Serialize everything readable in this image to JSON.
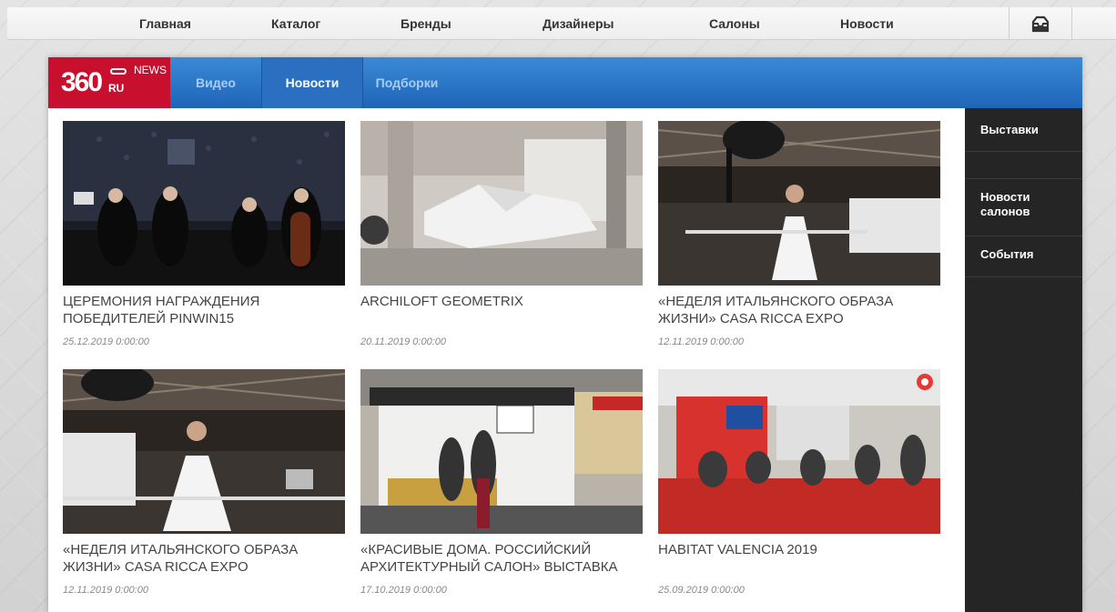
{
  "topnav": {
    "items": [
      "Главная",
      "Каталог",
      "Бренды",
      "Дизайнеры",
      "Салоны",
      "Новости"
    ]
  },
  "logo": {
    "main": "360",
    "badge": "NEWS",
    "ru": "RU"
  },
  "tabs": [
    "Видео",
    "Новости",
    "Подборки"
  ],
  "articles": [
    {
      "title": "Церемония награждения победителей PINWIN15",
      "date": "25.12.2019 0:00:00"
    },
    {
      "title": "ARCHILOFT GEOMETRIX",
      "date": "20.11.2019 0:00:00"
    },
    {
      "title": "«Неделя итальянского образа жизни» CASA RICCA EXPO",
      "date": "12.11.2019 0:00:00"
    },
    {
      "title": "«Неделя итальянского образа жизни» CASA RICCA EXPO",
      "date": "12.11.2019 0:00:00"
    },
    {
      "title": "«Красивые дома. Российский архитектурный салон» выставка",
      "date": "17.10.2019 0:00:00"
    },
    {
      "title": "HABITAT VALENCIA 2019",
      "date": "25.09.2019 0:00:00"
    }
  ],
  "sidebar": {
    "items": [
      "Выставки",
      "Новости салонов",
      "События"
    ]
  },
  "icons": {
    "cart": "cart-icon"
  },
  "colors": {
    "header_blue": "#2a6fc0",
    "logo_red": "#c8102e",
    "sidebar_dark": "#252525"
  }
}
